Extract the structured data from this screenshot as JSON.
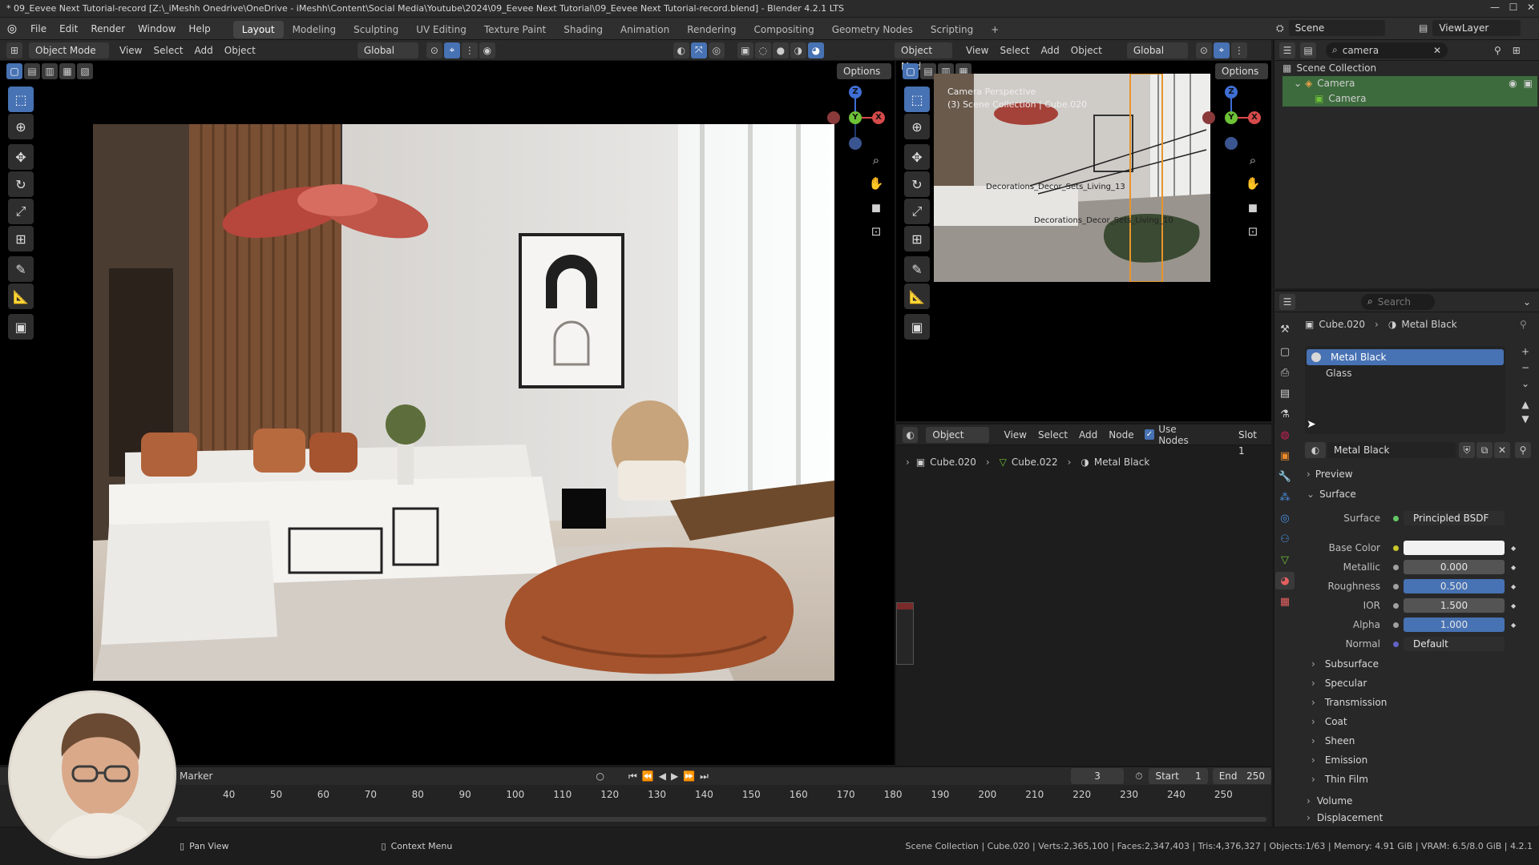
{
  "window": {
    "title": "* 09_Eevee Next Tutorial-record [Z:\\_iMeshh Onedrive\\OneDrive - iMeshh\\Content\\Social Media\\Youtube\\2024\\09_Eevee Next Tutorial\\09_Eevee Next Tutorial-record.blend] - Blender 4.2.1 LTS"
  },
  "menu": [
    "File",
    "Edit",
    "Render",
    "Window",
    "Help"
  ],
  "workspaces": [
    "Layout",
    "Modeling",
    "Sculpting",
    "UV Editing",
    "Texture Paint",
    "Shading",
    "Animation",
    "Rendering",
    "Compositing",
    "Geometry Nodes",
    "Scripting"
  ],
  "top_right": {
    "scene": "Scene",
    "view_layer": "ViewLayer"
  },
  "left_viewport": {
    "mode": "Object Mode",
    "menu": [
      "View",
      "Select",
      "Add",
      "Object"
    ],
    "transform": "Global",
    "options": "Options"
  },
  "right_viewport": {
    "mode": "Object Mode",
    "menu": [
      "View",
      "Select",
      "Add",
      "Object"
    ],
    "transform": "Global",
    "options": "Options",
    "overlay_line1": "Camera Perspective",
    "overlay_line2": "(3) Scene Collection | Cube.020",
    "labels": [
      "Decorations_Decor_Sets_Living_13",
      "Decorations_Decor_Sets_Living_10"
    ]
  },
  "gizmo": {
    "x": "X",
    "y": "Y",
    "z": "Z"
  },
  "node_editor": {
    "type": "Object",
    "menu": [
      "View",
      "Select",
      "Add",
      "Node"
    ],
    "use_nodes": "Use Nodes",
    "slot": "Slot 1",
    "breadcrumb": [
      "Cube.020",
      "Cube.022",
      "Metal Black"
    ]
  },
  "outliner": {
    "search": "camera",
    "root": "Scene Collection",
    "items": [
      "Camera",
      "Camera"
    ]
  },
  "properties": {
    "search_placeholder": "Search",
    "breadcrumb": [
      "Cube.020",
      "Metal Black"
    ],
    "slots": [
      "Metal Black",
      "Glass"
    ],
    "material": "Metal Black",
    "sections": {
      "preview": "Preview",
      "surface": "Surface"
    },
    "surface_row": {
      "label": "Surface",
      "value": "Principled BSDF"
    },
    "params": [
      {
        "label": "Base Color",
        "value": "",
        "style": "white",
        "socket": "yellow"
      },
      {
        "label": "Metallic",
        "value": "0.000",
        "style": "grey",
        "socket": "grey"
      },
      {
        "label": "Roughness",
        "value": "0.500",
        "style": "blue",
        "socket": "grey"
      },
      {
        "label": "IOR",
        "value": "1.500",
        "style": "grey",
        "socket": "grey"
      },
      {
        "label": "Alpha",
        "value": "1.000",
        "style": "blue",
        "socket": "grey"
      },
      {
        "label": "Normal",
        "value": "Default",
        "style": "dark",
        "socket": "purple"
      }
    ],
    "subpanels": [
      "Subsurface",
      "Specular",
      "Transmission",
      "Coat",
      "Sheen",
      "Emission",
      "Thin Film"
    ],
    "more": [
      "Volume",
      "Displacement"
    ]
  },
  "timeline": {
    "marker": "Marker",
    "current_frame": "3",
    "start_label": "Start",
    "start": "1",
    "end_label": "End",
    "end": "250",
    "ticks": [
      "40",
      "50",
      "60",
      "70",
      "80",
      "90",
      "100",
      "110",
      "120",
      "130",
      "140",
      "150",
      "160",
      "170",
      "180",
      "190",
      "200",
      "210",
      "220",
      "230",
      "240",
      "250"
    ]
  },
  "statusbar": {
    "pan": "Pan View",
    "context": "Context Menu",
    "info": "Scene Collection | Cube.020 | Verts:2,365,100 | Faces:2,347,403 | Tris:4,376,327 | Objects:1/63 | Memory: 4.91 GiB | VRAM: 6.5/8.0 GiB | 4.2.1"
  },
  "colors": {
    "accent": "#4772b3",
    "green_row": "#3d6b3d"
  }
}
